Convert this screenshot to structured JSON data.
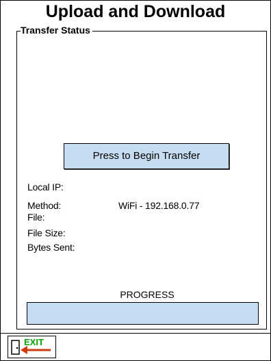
{
  "title": "Upload and Download",
  "transfer_status": {
    "legend": "Transfer Status",
    "begin_button": "Press to Begin Transfer",
    "local_ip_label": "Local IP:",
    "local_ip_value": "",
    "method_label": "Method:",
    "method_value": "WiFi - 192.168.0.77",
    "file_label": "File:",
    "file_value": "",
    "file_size_label": "File Size:",
    "file_size_value": "",
    "bytes_sent_label": "Bytes Sent:",
    "bytes_sent_value": "",
    "progress_label": "PROGRESS",
    "progress_percent": 0
  },
  "footer": {
    "exit_label": "EXIT",
    "exit_text_color": "#00a000",
    "exit_arrow_color": "#d23a0a"
  }
}
